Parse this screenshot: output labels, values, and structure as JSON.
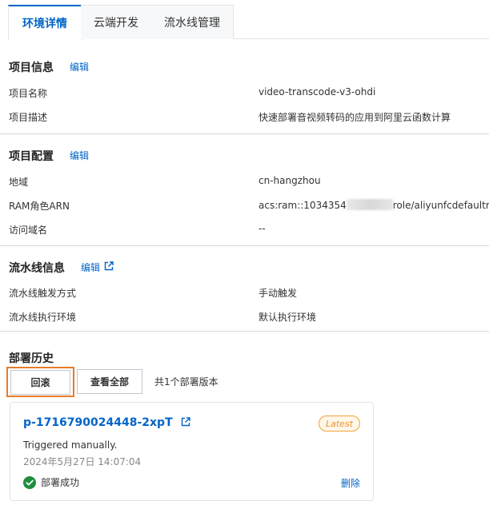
{
  "tabs": [
    {
      "label": "环境详情",
      "active": true
    },
    {
      "label": "云端开发",
      "active": false
    },
    {
      "label": "流水线管理",
      "active": false
    }
  ],
  "project_info": {
    "title": "项目信息",
    "edit_label": "编辑",
    "rows": [
      {
        "label": "项目名称",
        "value": "video-transcode-v3-ohdi"
      },
      {
        "label": "项目描述",
        "value": "快速部署音视频转码的应用到阿里云函数计算"
      }
    ]
  },
  "project_config": {
    "title": "项目配置",
    "edit_label": "编辑",
    "region_label": "地域",
    "region_value": "cn-hangzhou",
    "ram_label": "RAM角色ARN",
    "ram_value_prefix": "acs:ram::1034354",
    "ram_value_suffix": "role/aliyunfcdefaultrole",
    "domain_label": "访问域名",
    "domain_value": "--"
  },
  "pipeline_info": {
    "title": "流水线信息",
    "edit_label": "编辑",
    "rows": [
      {
        "label": "流水线触发方式",
        "value": "手动触发"
      },
      {
        "label": "流水线执行环境",
        "value": "默认执行环境"
      }
    ]
  },
  "deploy_history": {
    "title": "部署历史",
    "rollback_label": "回滚",
    "view_all_label": "查看全部",
    "count_text": "共1个部署版本",
    "card": {
      "id": "p-1716790024448-2xpT",
      "badge": "Latest",
      "trigger_text": "Triggered manually.",
      "time": "2024年5月27日 14:07:04",
      "status": "部署成功",
      "delete_label": "删除"
    }
  },
  "colors": {
    "accent": "#0064c8",
    "highlight": "#ea7b27",
    "success": "#1e8e3e"
  }
}
